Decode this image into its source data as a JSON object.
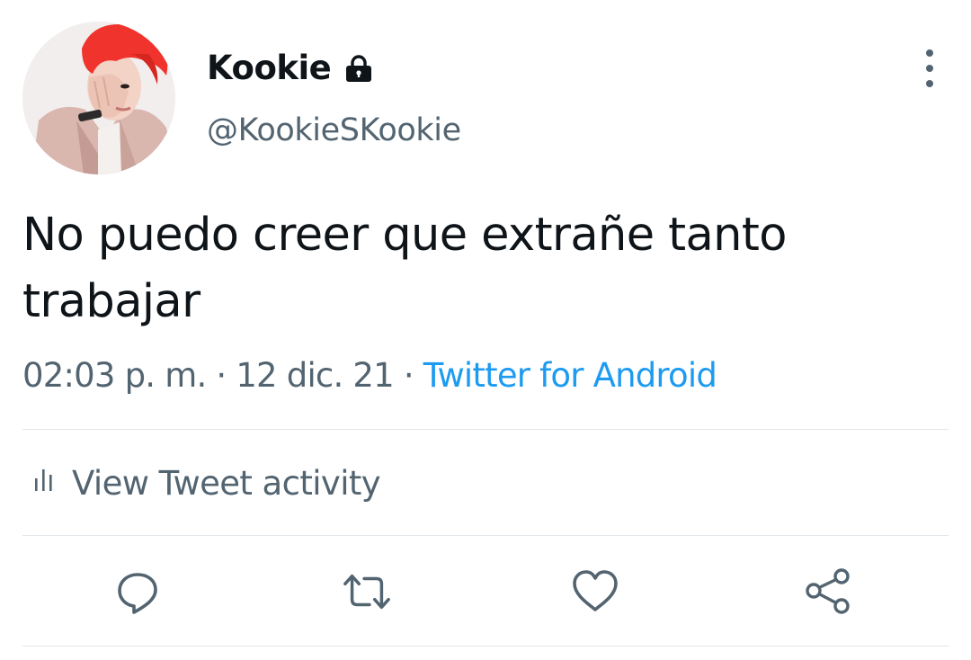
{
  "tweet": {
    "author": {
      "display_name": "Kookie",
      "handle": "@KookieSKookie",
      "protected_icon": "lock-icon",
      "avatar": "avatar-photo"
    },
    "text": "No puedo creer que extrañe tanto trabajar",
    "time": "02:03 p. m.",
    "separator": "·",
    "date": "12 dic. 21",
    "source": "Twitter for Android"
  },
  "activity": {
    "icon": "bar-chart-icon",
    "label": "View Tweet activity"
  },
  "actions": [
    {
      "name": "reply",
      "icon": "reply-icon"
    },
    {
      "name": "retweet",
      "icon": "retweet-icon"
    },
    {
      "name": "like",
      "icon": "heart-icon"
    },
    {
      "name": "share",
      "icon": "share-icon"
    }
  ],
  "colors": {
    "text": "#0f1419",
    "secondary": "#536471",
    "link": "#1d9bf0",
    "divider": "#e1e6ea",
    "hair": "#f0332c"
  }
}
